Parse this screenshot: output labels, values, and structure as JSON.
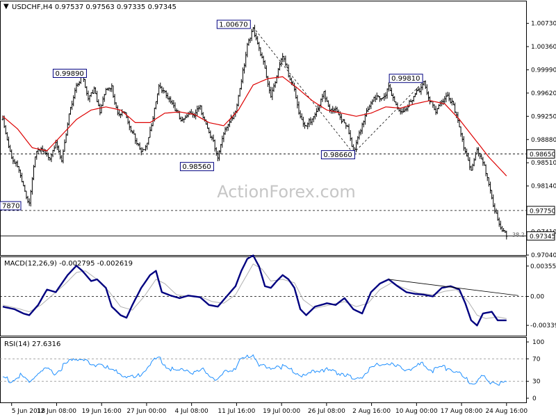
{
  "header": {
    "symbol_line": "USDCHF,H4  0.97537 0.97563 0.97335 0.97345"
  },
  "watermark": "ActionForex.com",
  "colors": {
    "bars": "#000000",
    "ma": "#dd0000",
    "macd": "#000080",
    "signal": "#b0b0b0",
    "rsi": "#1e8fff",
    "label_border": "#000080",
    "level_line": "#000000"
  },
  "chart_data": [
    {
      "type": "candlestick",
      "panel": "price",
      "title": "USDCHF,H4  0.97537 0.97563 0.97335 0.97345",
      "ylim": [
        0.9704,
        1.0108
      ],
      "y_ticks": [
        "1.00730",
        "1.00360",
        "0.99990",
        "0.99620",
        "0.99250",
        "0.98880",
        "0.98510",
        "0.98140",
        "0.97410",
        "0.97040"
      ],
      "x_ticks": [
        "5 Jun 2018",
        "12 Jun 08:00",
        "19 Jun 16:00",
        "27 Jun 00:00",
        "4 Jul 08:00",
        "11 Jul 16:00",
        "19 Jul 00:00",
        "26 Jul 08:00",
        "2 Aug 16:00",
        "10 Aug 00:00",
        "17 Aug 08:00",
        "24 Aug 16:00"
      ],
      "close_path": [
        [
          0,
          0.992
        ],
        [
          6,
          0.986
        ],
        [
          10,
          0.9845
        ],
        [
          14,
          0.981
        ],
        [
          18,
          0.9787
        ],
        [
          22,
          0.9865
        ],
        [
          26,
          0.987
        ],
        [
          32,
          0.986
        ],
        [
          36,
          0.9885
        ],
        [
          40,
          0.985
        ],
        [
          46,
          0.994
        ],
        [
          50,
          0.9975
        ],
        [
          54,
          0.9989
        ],
        [
          58,
          0.995
        ],
        [
          62,
          0.997
        ],
        [
          66,
          0.9935
        ],
        [
          70,
          0.9965
        ],
        [
          74,
          0.997
        ],
        [
          78,
          0.993
        ],
        [
          82,
          0.9935
        ],
        [
          86,
          0.9905
        ],
        [
          90,
          0.989
        ],
        [
          94,
          0.987
        ],
        [
          98,
          0.988
        ],
        [
          102,
          0.992
        ],
        [
          106,
          0.9975
        ],
        [
          110,
          0.9965
        ],
        [
          114,
          0.9945
        ],
        [
          118,
          0.993
        ],
        [
          122,
          0.992
        ],
        [
          126,
          0.993
        ],
        [
          130,
          0.9925
        ],
        [
          134,
          0.994
        ],
        [
          138,
          0.9915
        ],
        [
          142,
          0.989
        ],
        [
          146,
          0.9856
        ],
        [
          150,
          0.99
        ],
        [
          154,
          0.992
        ],
        [
          158,
          0.993
        ],
        [
          162,
          0.998
        ],
        [
          166,
          1.004
        ],
        [
          170,
          1.0067
        ],
        [
          174,
          1.003
        ],
        [
          178,
          1.0
        ],
        [
          182,
          0.996
        ],
        [
          186,
          0.999
        ],
        [
          190,
          1.002
        ],
        [
          194,
          0.999
        ],
        [
          198,
          0.997
        ],
        [
          202,
          0.992
        ],
        [
          206,
          0.9905
        ],
        [
          210,
          0.9925
        ],
        [
          214,
          0.994
        ],
        [
          218,
          0.996
        ],
        [
          222,
          0.993
        ],
        [
          226,
          0.994
        ],
        [
          230,
          0.992
        ],
        [
          234,
          0.9905
        ],
        [
          238,
          0.9866
        ],
        [
          242,
          0.99
        ],
        [
          246,
          0.9925
        ],
        [
          250,
          0.9945
        ],
        [
          254,
          0.996
        ],
        [
          258,
          0.9955
        ],
        [
          262,
          0.997
        ],
        [
          266,
          0.9945
        ],
        [
          270,
          0.9935
        ],
        [
          274,
          0.994
        ],
        [
          278,
          0.995
        ],
        [
          282,
          0.9965
        ],
        [
          286,
          0.9981
        ],
        [
          290,
          0.995
        ],
        [
          294,
          0.993
        ],
        [
          298,
          0.995
        ],
        [
          302,
          0.996
        ],
        [
          306,
          0.994
        ],
        [
          310,
          0.9905
        ],
        [
          314,
          0.987
        ],
        [
          318,
          0.984
        ],
        [
          322,
          0.987
        ],
        [
          326,
          0.985
        ],
        [
          330,
          0.982
        ],
        [
          334,
          0.9775
        ],
        [
          338,
          0.9745
        ],
        [
          342,
          0.9734
        ]
      ],
      "ma_path": [
        [
          0,
          0.9925
        ],
        [
          10,
          0.9905
        ],
        [
          20,
          0.9875
        ],
        [
          30,
          0.987
        ],
        [
          40,
          0.9895
        ],
        [
          50,
          0.992
        ],
        [
          60,
          0.9935
        ],
        [
          70,
          0.994
        ],
        [
          80,
          0.9935
        ],
        [
          90,
          0.9915
        ],
        [
          100,
          0.9915
        ],
        [
          110,
          0.993
        ],
        [
          120,
          0.9932
        ],
        [
          130,
          0.9928
        ],
        [
          140,
          0.9915
        ],
        [
          150,
          0.991
        ],
        [
          160,
          0.9935
        ],
        [
          170,
          0.9975
        ],
        [
          180,
          0.9985
        ],
        [
          190,
          0.9988
        ],
        [
          200,
          0.997
        ],
        [
          210,
          0.995
        ],
        [
          220,
          0.9935
        ],
        [
          230,
          0.993
        ],
        [
          240,
          0.9925
        ],
        [
          250,
          0.993
        ],
        [
          260,
          0.994
        ],
        [
          270,
          0.9938
        ],
        [
          280,
          0.9945
        ],
        [
          290,
          0.995
        ],
        [
          300,
          0.9945
        ],
        [
          310,
          0.992
        ],
        [
          320,
          0.989
        ],
        [
          330,
          0.986
        ],
        [
          342,
          0.983
        ]
      ],
      "horizontal_lines": [
        {
          "label": "0.98650",
          "value": 0.9865,
          "style": "dashed"
        },
        {
          "label": "0.97750",
          "value": 0.9775,
          "style": "dashed"
        },
        {
          "label": "0.97345",
          "value": 0.97345,
          "style": "solid"
        }
      ],
      "annotations": [
        {
          "text": "1.00670",
          "x": 170,
          "y": 1.0067
        },
        {
          "text": "0.99890",
          "x": 54,
          "y": 0.9989
        },
        {
          "text": "0.98560",
          "x": 146,
          "y": 0.9856
        },
        {
          "text": "0.98660",
          "x": 238,
          "y": 0.9866
        },
        {
          "text": "0.99810",
          "x": 286,
          "y": 0.9981
        },
        {
          "text": "7870",
          "x": 18,
          "y": 0.9787
        },
        {
          "text": "38.2",
          "x": 342,
          "y": 0.9731
        }
      ],
      "trendlines": [
        {
          "from": [
            170,
            1.0067
          ],
          "to": [
            238,
            0.9866
          ],
          "style": "dashed"
        },
        {
          "from": [
            238,
            0.9866
          ],
          "to": [
            286,
            0.9981
          ],
          "style": "dashed"
        }
      ]
    },
    {
      "type": "line",
      "panel": "macd",
      "title": "MACD(12,26,9) -0.002795 -0.002619",
      "ylim": [
        -0.0046,
        0.0046
      ],
      "y_ticks": [
        "0.003556",
        "0.00",
        "-0.003391"
      ],
      "macd_path": [
        [
          0,
          -0.0012
        ],
        [
          8,
          -0.0015
        ],
        [
          14,
          -0.002
        ],
        [
          18,
          -0.0022
        ],
        [
          24,
          -0.001
        ],
        [
          30,
          0.0008
        ],
        [
          36,
          0.0005
        ],
        [
          44,
          0.0025
        ],
        [
          50,
          0.0036
        ],
        [
          54,
          0.003
        ],
        [
          60,
          0.0018
        ],
        [
          64,
          0.002
        ],
        [
          70,
          0.001
        ],
        [
          74,
          -0.0012
        ],
        [
          80,
          -0.0022
        ],
        [
          84,
          -0.0025
        ],
        [
          88,
          -0.001
        ],
        [
          94,
          0.001
        ],
        [
          100,
          0.0025
        ],
        [
          104,
          0.003
        ],
        [
          108,
          0.0005
        ],
        [
          114,
          0.0001
        ],
        [
          120,
          -0.0002
        ],
        [
          126,
          0.0001
        ],
        [
          134,
          -0.0001
        ],
        [
          140,
          -0.001
        ],
        [
          146,
          -0.0012
        ],
        [
          152,
          0.0
        ],
        [
          158,
          0.0012
        ],
        [
          162,
          0.003
        ],
        [
          166,
          0.0044
        ],
        [
          170,
          0.0048
        ],
        [
          174,
          0.0035
        ],
        [
          178,
          0.0012
        ],
        [
          182,
          0.001
        ],
        [
          186,
          0.0018
        ],
        [
          190,
          0.0025
        ],
        [
          194,
          0.002
        ],
        [
          198,
          0.001
        ],
        [
          202,
          -0.0015
        ],
        [
          206,
          -0.0022
        ],
        [
          212,
          -0.0012
        ],
        [
          220,
          -0.0008
        ],
        [
          226,
          -0.001
        ],
        [
          232,
          -0.0002
        ],
        [
          238,
          -0.0015
        ],
        [
          244,
          -0.002
        ],
        [
          250,
          0.0005
        ],
        [
          256,
          0.0015
        ],
        [
          262,
          0.002
        ],
        [
          268,
          0.0012
        ],
        [
          274,
          0.0005
        ],
        [
          280,
          0.0003
        ],
        [
          286,
          0.0002
        ],
        [
          292,
          0.0
        ],
        [
          298,
          0.001
        ],
        [
          304,
          0.0012
        ],
        [
          310,
          0.0008
        ],
        [
          314,
          -0.0008
        ],
        [
          318,
          -0.0028
        ],
        [
          322,
          -0.0034
        ],
        [
          326,
          -0.002
        ],
        [
          332,
          -0.0018
        ],
        [
          336,
          -0.0028
        ],
        [
          342,
          -0.0028
        ]
      ],
      "signal_path": [
        [
          0,
          -0.001
        ],
        [
          10,
          -0.0014
        ],
        [
          18,
          -0.0018
        ],
        [
          26,
          -0.001
        ],
        [
          34,
          0.0002
        ],
        [
          42,
          0.0014
        ],
        [
          50,
          0.0028
        ],
        [
          56,
          0.003
        ],
        [
          64,
          0.002
        ],
        [
          72,
          0.0006
        ],
        [
          80,
          -0.0012
        ],
        [
          88,
          -0.0016
        ],
        [
          96,
          0.0
        ],
        [
          104,
          0.002
        ],
        [
          110,
          0.0015
        ],
        [
          118,
          0.0002
        ],
        [
          126,
          0.0
        ],
        [
          134,
          0.0
        ],
        [
          142,
          -0.0006
        ],
        [
          150,
          -0.0008
        ],
        [
          158,
          0.0002
        ],
        [
          164,
          0.002
        ],
        [
          170,
          0.0038
        ],
        [
          176,
          0.0032
        ],
        [
          182,
          0.0018
        ],
        [
          190,
          0.002
        ],
        [
          198,
          0.0016
        ],
        [
          204,
          -0.0004
        ],
        [
          212,
          -0.0014
        ],
        [
          222,
          -0.001
        ],
        [
          232,
          -0.0006
        ],
        [
          240,
          -0.0012
        ],
        [
          248,
          -0.0008
        ],
        [
          256,
          0.0008
        ],
        [
          264,
          0.0016
        ],
        [
          272,
          0.001
        ],
        [
          282,
          0.0004
        ],
        [
          292,
          0.0002
        ],
        [
          300,
          0.0006
        ],
        [
          308,
          0.0008
        ],
        [
          316,
          -0.0006
        ],
        [
          322,
          -0.0022
        ],
        [
          328,
          -0.0026
        ],
        [
          336,
          -0.0024
        ],
        [
          342,
          -0.0026
        ]
      ],
      "trendline": {
        "from": [
          262,
          0.002
        ],
        "to": [
          350,
          0.0001
        ]
      }
    },
    {
      "type": "line",
      "panel": "rsi",
      "title": "RSI(14) 27.6316",
      "ylim": [
        0,
        100
      ],
      "y_ticks": [
        "100",
        "70",
        "30",
        "0"
      ],
      "levels": [
        70,
        30
      ],
      "rsi_path": [
        [
          0,
          38
        ],
        [
          6,
          30
        ],
        [
          12,
          40
        ],
        [
          18,
          28
        ],
        [
          24,
          45
        ],
        [
          30,
          50
        ],
        [
          36,
          44
        ],
        [
          42,
          60
        ],
        [
          48,
          68
        ],
        [
          54,
          72
        ],
        [
          60,
          58
        ],
        [
          66,
          62
        ],
        [
          72,
          52
        ],
        [
          78,
          45
        ],
        [
          84,
          40
        ],
        [
          90,
          35
        ],
        [
          96,
          50
        ],
        [
          102,
          65
        ],
        [
          106,
          72
        ],
        [
          112,
          55
        ],
        [
          118,
          48
        ],
        [
          124,
          52
        ],
        [
          130,
          45
        ],
        [
          136,
          50
        ],
        [
          142,
          40
        ],
        [
          146,
          30
        ],
        [
          152,
          48
        ],
        [
          158,
          55
        ],
        [
          162,
          68
        ],
        [
          166,
          74
        ],
        [
          170,
          78
        ],
        [
          174,
          60
        ],
        [
          180,
          52
        ],
        [
          186,
          58
        ],
        [
          192,
          55
        ],
        [
          198,
          48
        ],
        [
          204,
          38
        ],
        [
          210,
          45
        ],
        [
          216,
          52
        ],
        [
          222,
          48
        ],
        [
          228,
          46
        ],
        [
          234,
          42
        ],
        [
          238,
          30
        ],
        [
          244,
          40
        ],
        [
          250,
          52
        ],
        [
          256,
          60
        ],
        [
          262,
          62
        ],
        [
          268,
          55
        ],
        [
          274,
          52
        ],
        [
          280,
          55
        ],
        [
          286,
          62
        ],
        [
          292,
          48
        ],
        [
          298,
          55
        ],
        [
          304,
          52
        ],
        [
          310,
          42
        ],
        [
          314,
          35
        ],
        [
          318,
          28
        ],
        [
          322,
          32
        ],
        [
          326,
          38
        ],
        [
          330,
          28
        ],
        [
          334,
          30
        ],
        [
          338,
          27
        ],
        [
          342,
          28
        ]
      ]
    }
  ]
}
